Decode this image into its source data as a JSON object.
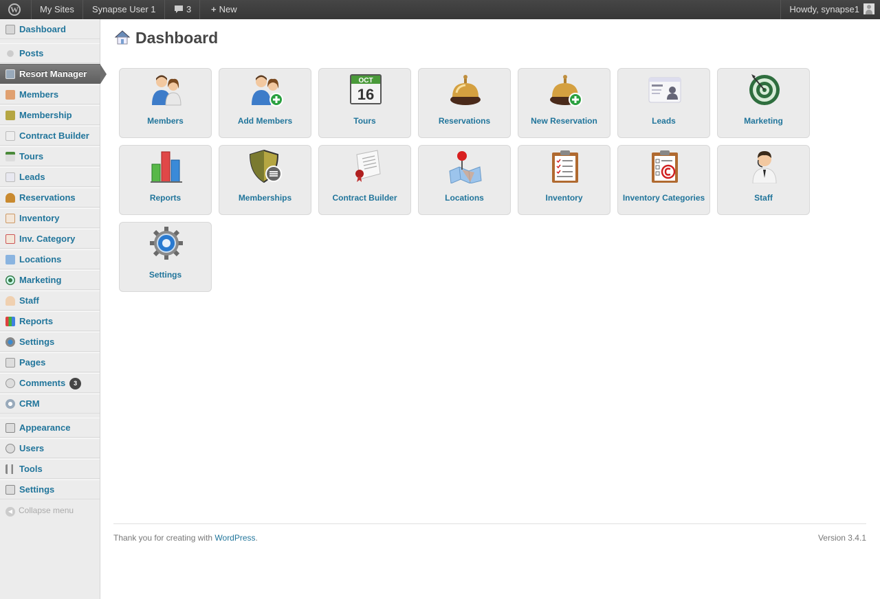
{
  "adminbar": {
    "my_sites": "My Sites",
    "site_name": "Synapse User 1",
    "comments_count": "3",
    "new_label": "New",
    "howdy": "Howdy, synapse1"
  },
  "sidebar": {
    "items": [
      {
        "label": "Dashboard",
        "icon": "dashboard-icon"
      },
      {
        "label": "Posts",
        "icon": "pin-icon"
      },
      {
        "label": "Resort Manager",
        "icon": "house-icon"
      },
      {
        "label": "Members",
        "icon": "members-icon"
      },
      {
        "label": "Membership",
        "icon": "membership-icon"
      },
      {
        "label": "Contract Builder",
        "icon": "contract-icon"
      },
      {
        "label": "Tours",
        "icon": "calendar-icon"
      },
      {
        "label": "Leads",
        "icon": "leads-icon"
      },
      {
        "label": "Reservations",
        "icon": "bell-icon"
      },
      {
        "label": "Inventory",
        "icon": "clipboard-icon"
      },
      {
        "label": "Inv. Category",
        "icon": "category-icon"
      },
      {
        "label": "Locations",
        "icon": "map-icon"
      },
      {
        "label": "Marketing",
        "icon": "target-icon"
      },
      {
        "label": "Staff",
        "icon": "staff-icon"
      },
      {
        "label": "Reports",
        "icon": "chart-icon"
      },
      {
        "label": "Settings",
        "icon": "gear-icon"
      },
      {
        "label": "Pages",
        "icon": "pages-icon"
      },
      {
        "label": "Comments",
        "icon": "comment-icon",
        "badge": "3"
      },
      {
        "label": "CRM",
        "icon": "crm-icon"
      },
      {
        "label": "Appearance",
        "icon": "appearance-icon"
      },
      {
        "label": "Users",
        "icon": "users-icon"
      },
      {
        "label": "Tools",
        "icon": "tools-icon"
      },
      {
        "label": "Settings",
        "icon": "settings-icon"
      }
    ],
    "collapse": "Collapse menu"
  },
  "page": {
    "title": "Dashboard"
  },
  "tiles": [
    {
      "label": "Members",
      "icon": "members-icon"
    },
    {
      "label": "Add Members",
      "icon": "add-members-icon"
    },
    {
      "label": "Tours",
      "icon": "calendar-icon"
    },
    {
      "label": "Reservations",
      "icon": "bell-icon"
    },
    {
      "label": "New Reservation",
      "icon": "new-reservation-icon"
    },
    {
      "label": "Leads",
      "icon": "id-card-icon"
    },
    {
      "label": "Marketing",
      "icon": "target-icon"
    },
    {
      "label": "Reports",
      "icon": "bar-chart-icon"
    },
    {
      "label": "Memberships",
      "icon": "shield-icon"
    },
    {
      "label": "Contract Builder",
      "icon": "contract-icon"
    },
    {
      "label": "Locations",
      "icon": "map-pin-icon"
    },
    {
      "label": "Inventory",
      "icon": "clipboard-icon"
    },
    {
      "label": "Inventory Categories",
      "icon": "clipboard-category-icon"
    },
    {
      "label": "Staff",
      "icon": "staff-icon"
    },
    {
      "label": "Settings",
      "icon": "gear-icon"
    }
  ],
  "calendar": {
    "month": "OCT",
    "day": "16"
  },
  "footer": {
    "thanks": "Thank you for creating with ",
    "wp_link": "WordPress",
    "period": ".",
    "version": "Version 3.4.1"
  }
}
